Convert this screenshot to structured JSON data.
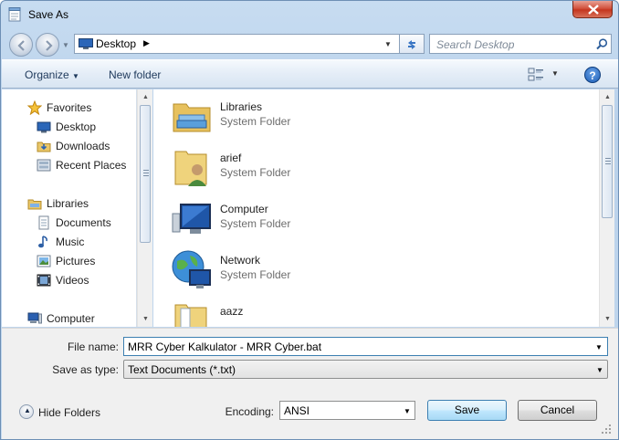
{
  "window": {
    "title": "Save As"
  },
  "address": {
    "crumb": "Desktop",
    "search_placeholder": "Search Desktop"
  },
  "toolbar": {
    "organize": "Organize",
    "new_folder": "New folder"
  },
  "nav": {
    "items": [
      {
        "label": "Favorites",
        "icon": "star-icon"
      },
      {
        "label": "Desktop",
        "icon": "desktop-icon"
      },
      {
        "label": "Downloads",
        "icon": "downloads-folder-icon"
      },
      {
        "label": "Recent Places",
        "icon": "recent-places-icon"
      },
      {
        "label": "Libraries",
        "icon": "libraries-icon"
      },
      {
        "label": "Documents",
        "icon": "documents-icon"
      },
      {
        "label": "Music",
        "icon": "music-icon"
      },
      {
        "label": "Pictures",
        "icon": "pictures-icon"
      },
      {
        "label": "Videos",
        "icon": "videos-icon"
      },
      {
        "label": "Computer",
        "icon": "computer-icon"
      }
    ]
  },
  "content": {
    "items": [
      {
        "name": "Libraries",
        "type": "System Folder",
        "icon": "libraries-folder-icon"
      },
      {
        "name": "arief",
        "type": "System Folder",
        "icon": "user-folder-icon"
      },
      {
        "name": "Computer",
        "type": "System Folder",
        "icon": "computer-icon"
      },
      {
        "name": "Network",
        "type": "System Folder",
        "icon": "network-icon"
      },
      {
        "name": "aazz",
        "type": "",
        "icon": "folder-icon"
      }
    ]
  },
  "form": {
    "file_name_label": "File name:",
    "file_name_value": "MRR Cyber Kalkulator - MRR Cyber.bat",
    "save_type_label": "Save as type:",
    "save_type_value": "Text Documents (*.txt)",
    "encoding_label": "Encoding:",
    "encoding_value": "ANSI"
  },
  "footer": {
    "hide_folders": "Hide Folders",
    "save": "Save",
    "cancel": "Cancel"
  },
  "colors": {
    "chrome": "#b9d1ea",
    "accent": "#3c7fb1",
    "close": "#c4361f"
  }
}
